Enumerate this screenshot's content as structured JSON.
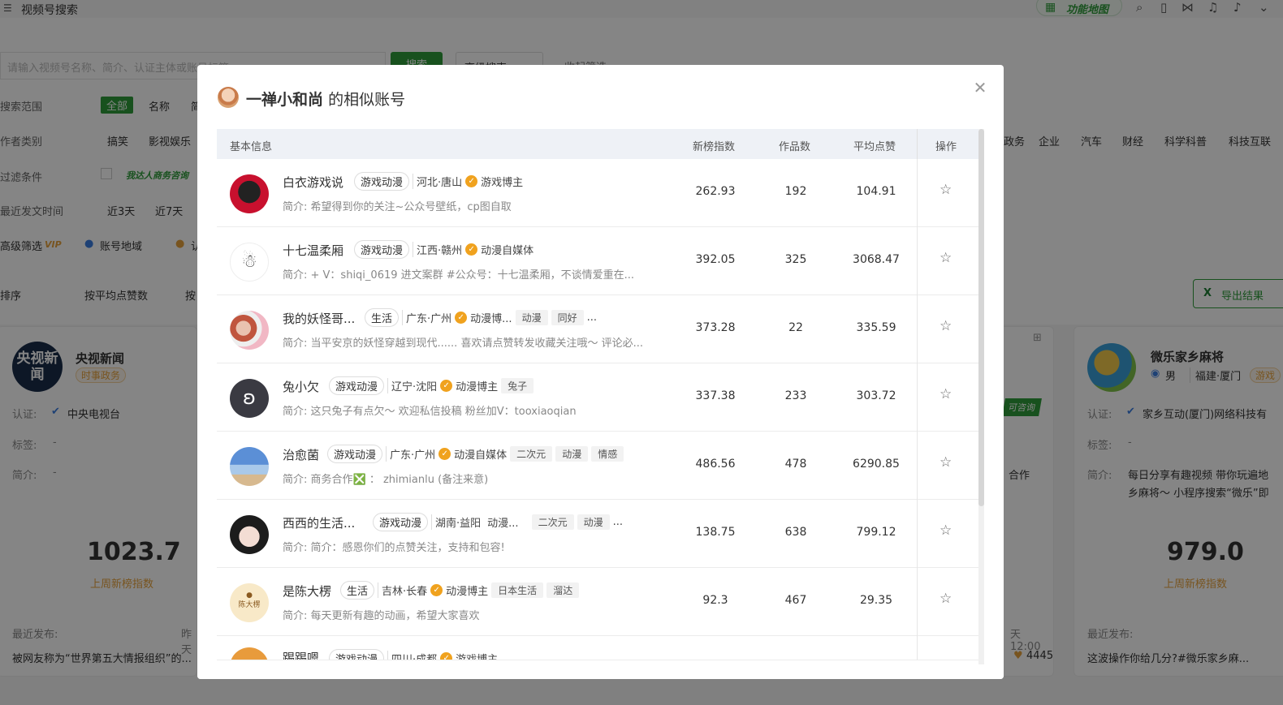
{
  "app": {
    "title": "视频号搜索",
    "func_map": "功能地图"
  },
  "search": {
    "placeholder": "请输入视频号名称、简介、认证主体或账号标签",
    "button": "搜索",
    "advanced": "高级搜索",
    "fold": "收起筛选"
  },
  "filters": {
    "scope_label": "搜索范围",
    "scope_options": [
      "全部",
      "名称",
      "简"
    ],
    "category_label": "作者类别",
    "categories_left": [
      "搞笑",
      "影视娱乐"
    ],
    "categories_right": [
      "政务",
      "企业",
      "汽车",
      "财经",
      "科学科普",
      "科技互联"
    ],
    "filter_label": "过滤条件",
    "filter_promo": "我达人商务咨询",
    "time_label": "最近发文时间",
    "time_options": [
      "近3天",
      "近7天"
    ],
    "advanced_label": "高级筛选",
    "vip": "VIP",
    "region": "账号地域",
    "cert": "认",
    "sort_label": "排序",
    "sort_option": "按平均点赞数",
    "sort_more": "按",
    "export": "导出结果"
  },
  "bg_cards": {
    "left": {
      "name": "央视新闻",
      "tag": "时事政务",
      "avatar_text": "央视新闻",
      "cert_label": "认证:",
      "cert_value": "中央电视台",
      "tag_label": "标签:",
      "tag_value": "-",
      "intro_label": "简介:",
      "intro_value": "-",
      "score": "1023.7",
      "score_label": "上周新榜指数",
      "recent_label": "最近发布:",
      "recent_time": "昨天",
      "recent_title": "被网友称为“世界第五大情报组织”的..."
    },
    "middle": {
      "badge": "可咨询",
      "coop": "合作",
      "time": "天 12:00",
      "likes": "4445"
    },
    "right": {
      "name": "微乐家乡麻将",
      "gender": "男",
      "region": "福建·厦门",
      "tag": "游戏",
      "cert_label": "认证:",
      "cert_value": "家乡互动(厦门)网络科技有",
      "tag_label": "标签:",
      "tag_value": "-",
      "intro_label": "简介:",
      "intro_value": "每日分享有趣视频 带你玩遍地",
      "intro_value2": "乡麻将～ 小程序搜索“微乐”即",
      "score": "979.0",
      "score_label": "上周新榜指数",
      "recent_label": "最近发布:",
      "recent_title": "这波操作你给几分?#微乐家乡麻..."
    }
  },
  "modal": {
    "account": "一禅小和尚",
    "suffix": "的相似账号",
    "headers": {
      "basic": "基本信息",
      "index": "新榜指数",
      "works": "作品数",
      "likes": "平均点赞",
      "action": "操作"
    },
    "rows": [
      {
        "name": "白衣游戏说",
        "category": "游戏动漫",
        "region": "河北·唐山",
        "verify": "游戏博主",
        "tags": [],
        "desc": "简介: 希望得到你的关注~公众号壁纸，cp图自取",
        "index": "262.93",
        "works": "192",
        "likes": "104.91"
      },
      {
        "name": "十七温柔厢",
        "category": "游戏动漫",
        "region": "江西·赣州",
        "verify": "动漫自媒体",
        "tags": [],
        "desc": "简介:     + V：shiqi_0619 进文案群 #公众号：十七温柔厢，不谈情爱重在...",
        "index": "392.05",
        "works": "325",
        "likes": "3068.47"
      },
      {
        "name": "我的妖怪哥...",
        "category": "生活",
        "region": "广东·广州",
        "verify": "动漫博...",
        "tags": [
          "动漫",
          "同好"
        ],
        "more": "...",
        "desc": "简介: 当平安京的妖怪穿越到现代...... 喜欢请点赞转发收藏关注哦～ 评论必...",
        "index": "373.28",
        "works": "22",
        "likes": "335.59"
      },
      {
        "name": "兔小欠",
        "category": "游戏动漫",
        "region": "辽宁·沈阳",
        "verify": "动漫博主",
        "tags": [
          "兔子"
        ],
        "desc": "简介: 这只兔子有点欠～ 欢迎私信投稿 粉丝加V：tooxiaoqian",
        "index": "337.38",
        "works": "233",
        "likes": "303.72"
      },
      {
        "name": "治愈菌",
        "category": "游戏动漫",
        "region": "广东·广州",
        "verify": "动漫自媒体",
        "tags": [
          "二次元",
          "动漫",
          "情感"
        ],
        "desc": "简介: 商务合作❎ ：  zhimianlu (备注来意)",
        "index": "486.56",
        "works": "478",
        "likes": "6290.85"
      },
      {
        "name": "西西的生活...",
        "category": "游戏动漫",
        "region": "湖南·益阳",
        "verify_plain": "动漫...",
        "tags": [
          "二次元",
          "动漫"
        ],
        "more": "...",
        "desc": "简介: 简介：感恩你们的点赞关注，支持和包容!",
        "index": "138.75",
        "works": "638",
        "likes": "799.12"
      },
      {
        "name": "是陈大楞",
        "category": "生活",
        "region": "吉林·长春",
        "verify": "动漫博主",
        "tags": [
          "日本生活",
          "溜达"
        ],
        "desc": "简介: 每天更新有趣的动画，希望大家喜欢",
        "index": "92.3",
        "works": "467",
        "likes": "29.35"
      },
      {
        "name": "踢踢嗯",
        "category": "游戏动漫",
        "region": "四川·成都",
        "verify": "游戏博主",
        "tags": [],
        "desc": "",
        "index": "",
        "works": "",
        "likes": ""
      }
    ],
    "avatar_texts": {
      "row2": "陈大楞"
    }
  },
  "colors": {
    "brand_green": "#2e9c3a",
    "verify_gold": "#f0a21e",
    "vip_orange": "#e6a23c"
  }
}
